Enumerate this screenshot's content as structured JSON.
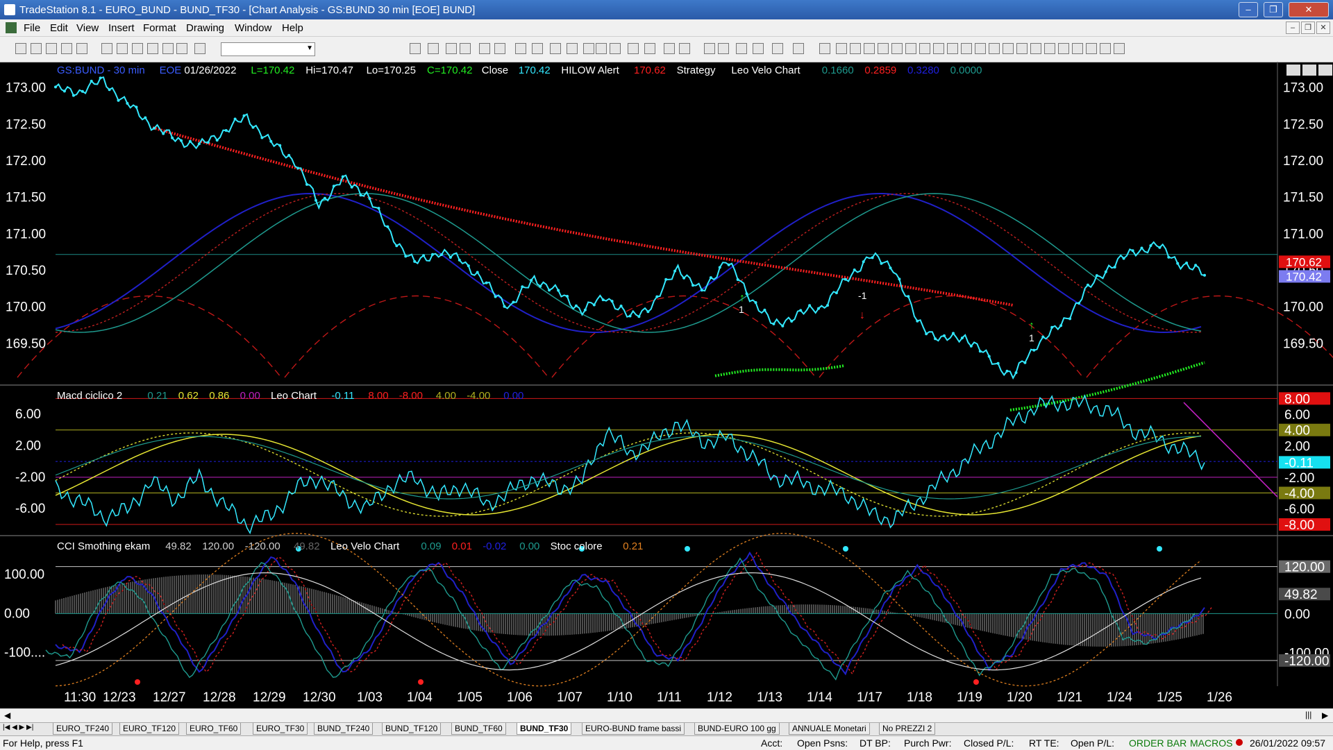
{
  "window": {
    "title": "TradeStation 8.1 - EURO_BUND - BUND_TF30 - [Chart Analysis - GS:BUND  30 min  [EOE] BUND]",
    "minimize": "–",
    "maximize": "❐",
    "close": "✕"
  },
  "menu": [
    "File",
    "Edit",
    "View",
    "Insert",
    "Format",
    "Drawing",
    "Window",
    "Help"
  ],
  "mdi_buttons": [
    "–",
    "❐",
    "✕"
  ],
  "panels": {
    "price": {
      "symbol": "GS:BUND - 30 min",
      "eoe": "EOE",
      "date": "01/26/2022",
      "last": "L=170.42",
      "high": "Hi=170.47",
      "low": "Lo=170.25",
      "close": "C=170.42",
      "close_label": "Close",
      "close_value": "170.42",
      "hilow_label": "HILOW Alert",
      "hilow_value": "170.62",
      "strategy_label": "Strategy",
      "leo_label": "Leo Velo Chart",
      "leo_values": [
        "0.1660",
        "0.2859",
        "0.3280",
        "0.0000"
      ],
      "badge_upper": "170.62",
      "badge_lower": "170.42",
      "marker_labels": [
        "1",
        "-1",
        "1"
      ]
    },
    "macd": {
      "label": "Macd ciclico 2",
      "values": [
        "0.21",
        "0.62",
        "0.86",
        "0.00"
      ],
      "leo_label": "Leo Chart",
      "leo_values": [
        "-0.11",
        "8.00",
        "-8.00",
        "4.00",
        "-4.00",
        "0.00"
      ],
      "badges": [
        "8.00",
        "6.00",
        "4.00",
        "2.00",
        "-0.11",
        "-2.00",
        "-4.00",
        "-6.00",
        "-8.00"
      ]
    },
    "cci": {
      "label": "CCI Smothing ekam",
      "values": [
        "49.82",
        "120.00",
        "-120.00",
        "49.82"
      ],
      "leo_label": "Leo Velo Chart",
      "leo_values": [
        "0.09",
        "0.01",
        "-0.02",
        "0.00"
      ],
      "stoc_label": "Stoc colore",
      "stoc_value": "0.21",
      "badges": [
        "120.00",
        "49.82",
        "0.00",
        "-100.00",
        "-120.00"
      ]
    }
  },
  "colors": {
    "price_bar": "#33e8ff",
    "hilow_red": "#ff2020",
    "green_line": "#22ee22",
    "blue_band": "#2020c8",
    "teal_band": "#1e9a8e",
    "yellow": "#e6e632",
    "magenta": "#c020c0",
    "orange_dot": "#e08020"
  },
  "chart_data": [
    {
      "type": "line",
      "title": "GS:BUND - 30 min",
      "ylim": [
        169.0,
        173.3
      ],
      "yticks": [
        "173.00",
        "172.50",
        "172.00",
        "171.50",
        "171.00",
        "170.50",
        "170.00",
        "169.50"
      ],
      "ytick_values": [
        173.0,
        172.5,
        172.0,
        171.5,
        171.0,
        170.5,
        170.0,
        169.5
      ],
      "x_labels": [
        "11:30",
        "12/23",
        "12/27",
        "12/28",
        "12/29",
        "12/30",
        "1/03",
        "1/04",
        "1/05",
        "1/06",
        "1/07",
        "1/10",
        "1/11",
        "1/12",
        "1/13",
        "1/14",
        "1/17",
        "1/18",
        "1/19",
        "1/20",
        "1/21",
        "1/24",
        "1/25",
        "1/26"
      ],
      "series": [
        {
          "values": [
            172.98,
            172.95,
            173.1,
            172.78,
            172.5,
            172.3,
            172.2,
            172.4,
            172.6,
            172.25,
            172.0,
            171.4,
            171.75,
            171.55,
            171.0,
            170.6,
            170.75,
            170.65,
            170.3,
            170.0,
            170.4,
            170.2,
            169.95,
            170.15,
            169.85,
            170.05,
            170.55,
            170.2,
            170.65,
            170.15,
            169.75,
            169.9,
            170.0,
            170.35,
            170.7,
            170.55,
            169.8,
            169.55,
            169.6,
            169.3,
            169.05,
            169.5,
            169.75,
            170.2,
            170.55,
            170.75,
            170.85,
            170.6,
            170.45
          ]
        }
      ]
    },
    {
      "type": "line",
      "title": "Macd ciclico 2",
      "ylim": [
        -8.8,
        9.0
      ],
      "yticks": [
        "6.00",
        "2.00",
        "-2.00",
        "-6.00"
      ],
      "ytick_values": [
        6,
        2,
        -2,
        -6
      ],
      "series": [
        {
          "values": [
            -3.5,
            -5.0,
            -7.0,
            -6.2,
            -2.5,
            -4.8,
            -2.0,
            -5.5,
            -8.0,
            -7.0,
            -3.5,
            -2.0,
            -4.5,
            -6.0,
            -3.0,
            -2.0,
            -4.5,
            -3.0,
            -5.5,
            -3.8,
            -2.0,
            -3.5,
            -2.5,
            4.0,
            1.0,
            2.5,
            5.0,
            2.5,
            3.0,
            1.0,
            -2.0,
            -2.5,
            -3.5,
            -4.0,
            -6.5,
            -7.5,
            -5.0,
            -2.5,
            0.0,
            2.5,
            5.0,
            7.0,
            7.5,
            7.2,
            6.5,
            4.0,
            3.0,
            1.5,
            0.0
          ]
        }
      ]
    },
    {
      "type": "line",
      "title": "CCI Smothing ekam",
      "ylim": [
        -175,
        185
      ],
      "yticks": [
        "100.00",
        "0.00",
        "-100...."
      ],
      "ytick_values": [
        100,
        0,
        -100
      ],
      "series": [
        {
          "values": [
            -80,
            -100,
            20,
            100,
            50,
            -50,
            -150,
            -60,
            50,
            150,
            80,
            -50,
            -150,
            -100,
            0,
            100,
            130,
            50,
            -50,
            -130,
            -60,
            20,
            100,
            80,
            0,
            -100,
            -120,
            -20,
            90,
            150,
            60,
            -20,
            -90,
            -150,
            -40,
            60,
            120,
            60,
            -40,
            -140,
            -100,
            0,
            110,
            130,
            90,
            -50,
            -60,
            -30,
            10
          ]
        }
      ]
    }
  ],
  "tabs": [
    "EURO_TF240",
    "EURO_TF120",
    "EURO_TF60",
    "EURO_TF30",
    "BUND_TF240",
    "BUND_TF120",
    "BUND_TF60",
    "BUND_TF30",
    "EURO-BUND frame bassi",
    "BUND-EURO 100 gg",
    "ANNUALE Monetari",
    "No PREZZI 2"
  ],
  "active_tab": "BUND_TF30",
  "status": {
    "help": "For Help, press F1",
    "acct": "Acct:",
    "open_psns": "Open Psns:",
    "dt_bp": "DT BP:",
    "purch_pwr": "Purch Pwr:",
    "closed_pl": "Closed P/L:",
    "rt_te": "RT TE:",
    "open_pl": "Open P/L:",
    "order_bar": "ORDER BAR",
    "macros": "MACROS",
    "datetime": "26/01/2022 09:57"
  }
}
